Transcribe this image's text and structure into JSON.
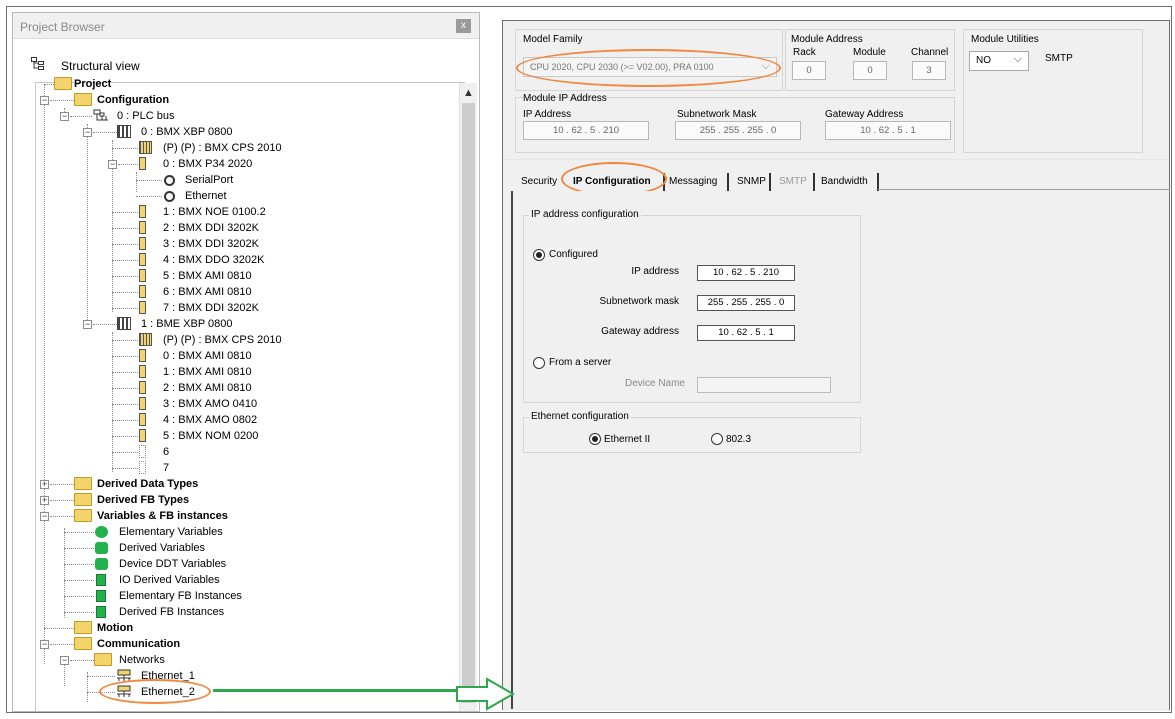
{
  "project_browser": {
    "title": "Project Browser",
    "close_glyph": "x",
    "view_label": "Structural view",
    "tree": {
      "project": "Project",
      "configuration": "Configuration",
      "plc_bus": "0 : PLC bus",
      "rack0": "0 : BMX XBP 0800",
      "rack0_items": [
        "(P) (P) : BMX CPS 2010",
        "0 : BMX P34 2020",
        "SerialPort",
        "Ethernet",
        "1 : BMX NOE 0100.2",
        "2 : BMX DDI 3202K",
        "3 : BMX DDI 3202K",
        "4 : BMX DDO 3202K",
        "5 : BMX AMI 0810",
        "6 : BMX AMI 0810",
        "7 : BMX DDI 3202K"
      ],
      "rack1": "1 : BME XBP 0800",
      "rack1_items": [
        "(P) (P) : BMX CPS 2010",
        "0 : BMX AMI 0810",
        "1 : BMX AMI 0810",
        "2 : BMX AMI 0810",
        "3 : BMX AMO 0410",
        "4 : BMX AMO 0802",
        "5 : BMX NOM 0200",
        "6",
        "7"
      ],
      "derived_data_types": "Derived Data Types",
      "derived_fb_types": "Derived FB Types",
      "variables": "Variables & FB instances",
      "variables_items": [
        "Elementary Variables",
        "Derived Variables",
        "Device DDT Variables",
        "IO Derived Variables",
        "Elementary FB Instances",
        "Derived FB Instances"
      ],
      "motion": "Motion",
      "communication": "Communication",
      "networks": "Networks",
      "networks_items": [
        "Ethernet_1",
        "Ethernet_2"
      ]
    }
  },
  "module_panel": {
    "model_family": {
      "label": "Model Family",
      "value": "CPU 2020, CPU 2030 (>= V02.00), PRA 0100"
    },
    "module_address": {
      "label": "Module Address",
      "rack_label": "Rack",
      "module_label": "Module",
      "channel_label": "Channel",
      "rack": "0",
      "module": "0",
      "channel": "3"
    },
    "module_utilities": {
      "label": "Module Utilities",
      "value": "NO",
      "smtp_label": "SMTP"
    },
    "module_ip": {
      "label": "Module IP Address",
      "ip_label": "IP Address",
      "mask_label": "Subnetwork Mask",
      "gateway_label": "Gateway Address",
      "ip": "10  .  62  .   5   .  210",
      "mask": "255  .  255  .  255  .   0",
      "gateway": "10  .  62  .   5   .   1"
    },
    "tabs": [
      "Security",
      "IP Configuration",
      "Messaging",
      "SNMP",
      "SMTP",
      "Bandwidth"
    ],
    "active_tab": "IP Configuration",
    "ip_config": {
      "group_label": "IP address configuration",
      "configured_label": "Configured",
      "ip_label": "IP address",
      "ip_value": "10  .  62  .   5   .  210",
      "mask_label": "Subnetwork mask",
      "mask_value": "255 . 255 . 255 .  0",
      "gateway_label": "Gateway address",
      "gateway_value": "10  .  62  .   5   .   1",
      "from_server_label": "From a server",
      "device_name_label": "Device Name",
      "device_name_value": ""
    },
    "eth_config": {
      "group_label": "Ethernet configuration",
      "option1": "Ethernet II",
      "option2": "802.3",
      "selected": "Ethernet II"
    }
  },
  "colors": {
    "highlight": "#f0873c",
    "arrow": "#2ea84a",
    "folder": "#f3d36b",
    "variable_icon": "#22b14c"
  }
}
